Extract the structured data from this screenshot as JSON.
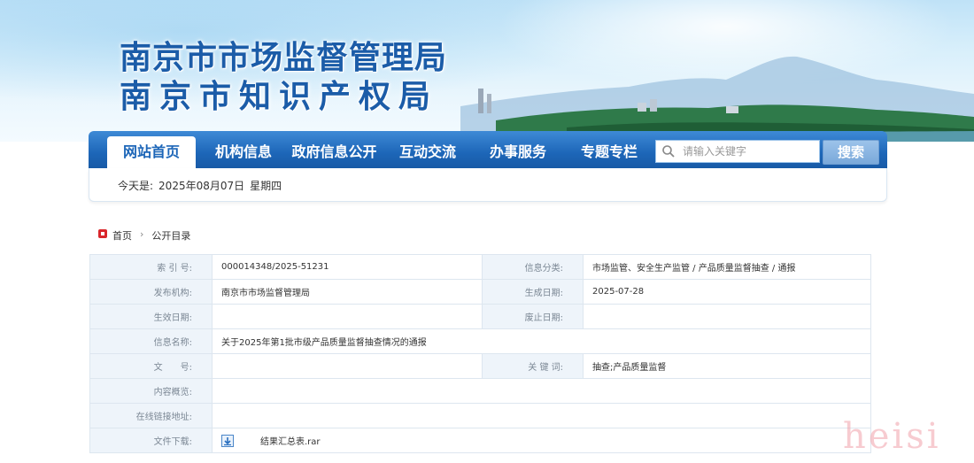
{
  "header": {
    "title_line1": "南京市市场监督管理局",
    "title_line2": "南京市知识产权局"
  },
  "nav": {
    "items": [
      {
        "label": "网站首页",
        "active": true
      },
      {
        "label": "机构信息"
      },
      {
        "label": "政府信息公开"
      },
      {
        "label": "互动交流"
      },
      {
        "label": "办事服务"
      },
      {
        "label": "专题专栏"
      }
    ]
  },
  "search": {
    "placeholder": "请输入关键字",
    "button_label": "搜索"
  },
  "date_bar": {
    "prefix": "今天是:",
    "date": "2025年08月07日",
    "weekday": "星期四"
  },
  "breadcrumb": {
    "home": "首页",
    "current": "公开目录"
  },
  "info_table": {
    "index_label": "索 引 号:",
    "index_value": "000014348/2025-51231",
    "category_label": "信息分类:",
    "category_value": "市场监管、安全生产监管 / 产品质量监督抽查 / 通报",
    "publisher_label": "发布机构:",
    "publisher_value": "南京市市场监督管理局",
    "created_label": "生成日期:",
    "created_value": "2025-07-28",
    "effective_label": "生效日期:",
    "effective_value": "",
    "expire_label": "废止日期:",
    "expire_value": "",
    "name_label": "信息名称:",
    "name_value": "关于2025年第1批市级产品质量监督抽查情况的通报",
    "docno_label": "文　　号:",
    "docno_value": "",
    "keywords_label": "关 键 词:",
    "keywords_value": "抽查;产品质量监督",
    "summary_label": "内容概览:",
    "summary_value": "",
    "link_label": "在线链接地址:",
    "link_value": "",
    "download_label": "文件下载:",
    "download_file": "结果汇总表.rar"
  },
  "watermark": "heisi",
  "colors": {
    "nav_blue": "#1d66b8",
    "title_blue": "#1b5ca8",
    "label_bg": "#eef4fa"
  }
}
